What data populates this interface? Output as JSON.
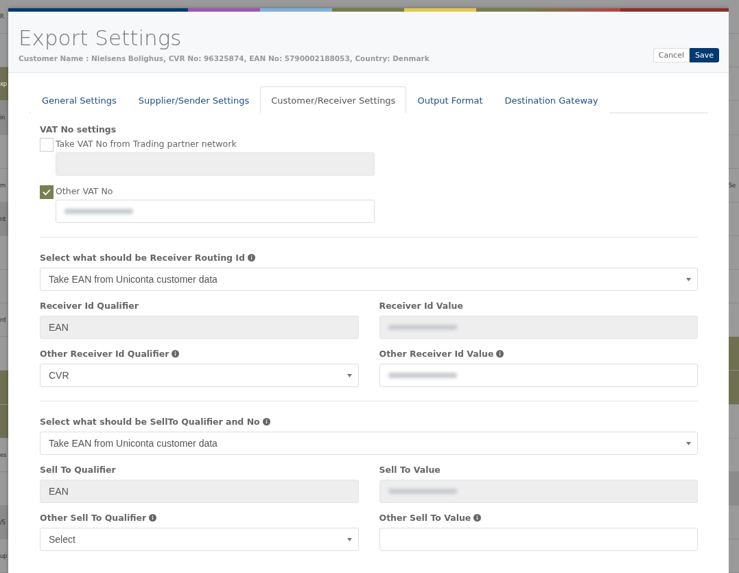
{
  "background": {
    "left_rows": [
      {
        "text": "R",
        "kind": "plain"
      },
      {
        "kind": "plain"
      },
      {
        "text": "xp",
        "kind": "olive"
      },
      {
        "text": "in",
        "kind": "band"
      },
      {
        "kind": "plain"
      },
      {
        "text": "m",
        "kind": "plain"
      },
      {
        "text": "nt",
        "kind": "band"
      },
      {
        "kind": "plain"
      },
      {
        "kind": "plain"
      },
      {
        "text": "rd",
        "kind": "plain"
      },
      {
        "kind": "plain"
      },
      {
        "kind": "olive"
      },
      {
        "kind": "olive"
      },
      {
        "text": "es",
        "kind": "plain"
      },
      {
        "kind": "plain"
      },
      {
        "text": "/S",
        "kind": "band"
      },
      {
        "text": "up",
        "kind": "plain"
      }
    ],
    "right_rows": [
      {
        "kind": "plain"
      },
      {
        "kind": "plain"
      },
      {
        "kind": "plain"
      },
      {
        "kind": "plain"
      },
      {
        "kind": "plain"
      },
      {
        "text": "Se",
        "kind": "plain"
      },
      {
        "kind": "plain"
      },
      {
        "kind": "plain"
      },
      {
        "kind": "plain"
      },
      {
        "kind": "plain"
      },
      {
        "kind": "olive"
      },
      {
        "kind": "olive"
      },
      {
        "kind": "plain"
      },
      {
        "kind": "plain"
      },
      {
        "kind": "band"
      },
      {
        "kind": "plain"
      },
      {
        "kind": "plain"
      }
    ]
  },
  "dialog": {
    "title": "Export Settings",
    "subtitle": "Customer Name : Nielsens Bolighus, CVR No: 96325874, EAN No: 5790002188053, Country: Denmark",
    "buttons": [
      {
        "label": "Cancel",
        "kind": "secondary"
      },
      {
        "label": "Save",
        "kind": "primary"
      }
    ],
    "tabs": [
      {
        "label": "General Settings",
        "selected": false
      },
      {
        "label": "Supplier/Sender Settings",
        "selected": false
      },
      {
        "label": "Customer/Receiver Settings",
        "selected": true
      },
      {
        "label": "Output Format",
        "selected": false
      },
      {
        "label": "Destination Gateway",
        "selected": false
      }
    ],
    "vat_settings": {
      "heading": "VAT No settings",
      "options": [
        {
          "label": "Take VAT No from Trading partner network",
          "checked": false,
          "field": {
            "disabled": true,
            "redacted": false
          }
        },
        {
          "label": "Other VAT No",
          "checked": true,
          "field": {
            "disabled": false,
            "redacted": true
          }
        }
      ]
    },
    "sections": [
      {
        "select_label": "Select what should be Receiver Routing Id",
        "info": true,
        "select_value": "Take EAN from Uniconta customer data",
        "rows": [
          [
            {
              "label": "Receiver Id Qualifier",
              "info": false,
              "kind": "readonly",
              "value": "EAN"
            },
            {
              "label": "Receiver Id Value",
              "info": false,
              "kind": "readonly",
              "redacted": true
            }
          ],
          [
            {
              "label": "Other Receiver Id Qualifier",
              "info": true,
              "kind": "select",
              "value": "CVR"
            },
            {
              "label": "Other Receiver Id Value",
              "info": true,
              "kind": "input",
              "redacted": true
            }
          ]
        ]
      },
      {
        "select_label": "Select what should be SellTo Qualifier and No",
        "info": true,
        "select_value": "Take EAN from Uniconta customer data",
        "rows": [
          [
            {
              "label": "Sell To Qualifier",
              "info": false,
              "kind": "readonly",
              "value": "EAN"
            },
            {
              "label": "Sell To Value",
              "info": false,
              "kind": "readonly",
              "redacted": true
            }
          ],
          [
            {
              "label": "Other Sell To Qualifier",
              "info": true,
              "kind": "select",
              "value": "Select"
            },
            {
              "label": "Other Sell To Value",
              "info": true,
              "kind": "input",
              "redacted": false
            }
          ]
        ]
      }
    ]
  }
}
